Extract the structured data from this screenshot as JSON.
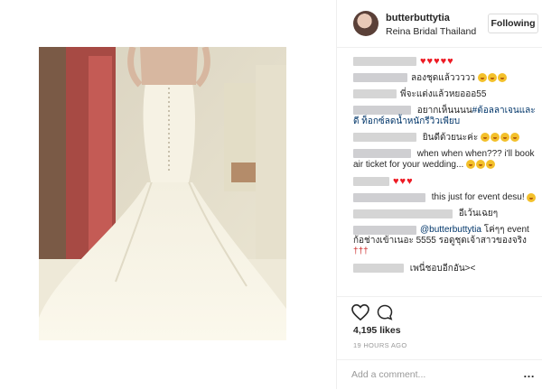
{
  "post": {
    "username": "butterbuttytia",
    "location": "Reina Bridal Thailand",
    "follow_label": "Following",
    "likes": "4,195 likes",
    "timestamp": "19 HOURS AGO",
    "add_comment_placeholder": "Add a comment...",
    "more_glyph": "…"
  },
  "comments": [
    {
      "parts": [
        {
          "t": "hearts",
          "n": 5
        }
      ]
    },
    {
      "parts": [
        {
          "t": "text",
          "v": "ลองชุดแล้ววววว "
        },
        {
          "t": "emoji",
          "n": 3
        }
      ]
    },
    {
      "parts": [
        {
          "t": "text",
          "v": "พี่จะแต่งแล้วหยอออ55"
        }
      ]
    },
    {
      "parts": [
        {
          "t": "text",
          "v": " อยากเห็นนนน"
        },
        {
          "t": "mention",
          "v": "#ต้อลลาเจนและดี ท็อกซ์ลดน้ำหนักรีวิวเพียบ"
        }
      ]
    },
    {
      "parts": [
        {
          "t": "text",
          "v": " ยินดีด้วยนะค่ะ "
        },
        {
          "t": "emoji",
          "n": 4
        }
      ]
    },
    {
      "parts": [
        {
          "t": "text",
          "v": " when when when??? i'll book air ticket for your wedding... "
        },
        {
          "t": "emoji",
          "n": 3
        }
      ]
    },
    {
      "parts": [
        {
          "t": "hearts",
          "n": 3
        }
      ]
    },
    {
      "parts": [
        {
          "t": "text",
          "v": " this just for event desu! "
        },
        {
          "t": "emoji",
          "n": 1
        }
      ]
    },
    {
      "parts": [
        {
          "t": "text",
          "v": " อีเว้นเฉยๆ"
        }
      ]
    },
    {
      "parts": [
        {
          "t": "mention",
          "v": "@butterbuttytia"
        },
        {
          "t": "text",
          "v": " โค่ๆๆ event ก้อช่างเข้าเนอะ 5555 รอดูชุดเจ้าสาวของจริง "
        },
        {
          "t": "pins",
          "n": 3
        }
      ]
    },
    {
      "parts": [
        {
          "t": "text",
          "v": " เพนี่ชอบอีกอัน>< "
        }
      ]
    }
  ]
}
